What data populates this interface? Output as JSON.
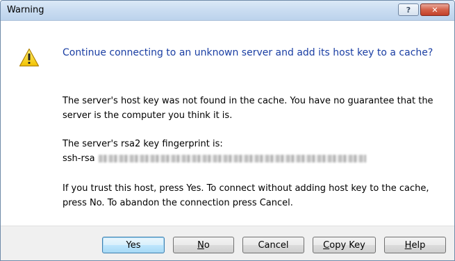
{
  "window": {
    "title": "Warning"
  },
  "titlebar_buttons": {
    "help": "?",
    "close": "✕"
  },
  "icon": "warning-triangle",
  "message": {
    "heading": "Continue connecting to an unknown server and add its host key to a cache?",
    "paragraph1": "The server's host key was not found in the cache. You have no guarantee that the server is the computer you think it is.",
    "fingerprint_label": "The server's rsa2 key fingerprint is:",
    "fingerprint_prefix": "ssh-rsa",
    "paragraph3": "If you trust this host, press Yes. To connect without adding host key to the cache, press No. To abandon the connection press Cancel."
  },
  "buttons": {
    "yes": "Yes",
    "no_key": "N",
    "no_rest": "o",
    "cancel": "Cancel",
    "copy_key": "C",
    "copy_rest": "opy Key",
    "help_key": "H",
    "help_rest": "elp"
  },
  "colors": {
    "heading": "#1a3ea3",
    "footer_bg": "#f0f0f0",
    "titlebar": "#c9dcf1",
    "close": "#c2412a"
  }
}
